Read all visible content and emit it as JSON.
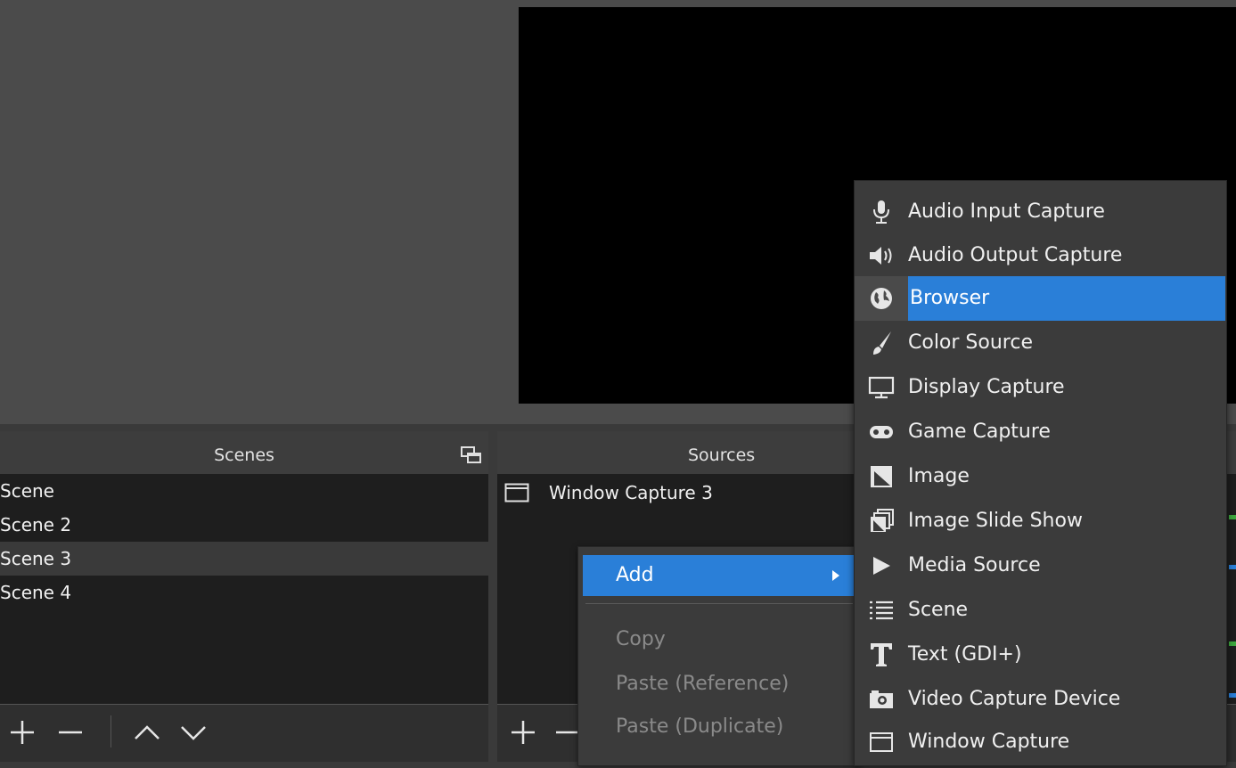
{
  "scenes": {
    "title": "Scenes",
    "items": [
      "Scene",
      "Scene 2",
      "Scene 3",
      "Scene 4"
    ],
    "selected_index": 2
  },
  "sources": {
    "title": "Sources",
    "items": [
      {
        "label": "Window Capture 3",
        "icon": "window-capture-icon"
      }
    ]
  },
  "context_menu": {
    "add_label": "Add",
    "copy_label": "Copy",
    "paste_reference_label": "Paste (Reference)",
    "paste_duplicate_label": "Paste (Duplicate)"
  },
  "add_submenu": {
    "items": [
      {
        "label": "Audio Input Capture",
        "icon": "microphone-icon"
      },
      {
        "label": "Audio Output Capture",
        "icon": "speaker-icon"
      },
      {
        "label": "Browser",
        "icon": "globe-icon"
      },
      {
        "label": "Color Source",
        "icon": "paint-brush-icon"
      },
      {
        "label": "Display Capture",
        "icon": "monitor-icon"
      },
      {
        "label": "Game Capture",
        "icon": "gamepad-icon"
      },
      {
        "label": "Image",
        "icon": "image-icon"
      },
      {
        "label": "Image Slide Show",
        "icon": "slideshow-icon"
      },
      {
        "label": "Media Source",
        "icon": "play-icon"
      },
      {
        "label": "Scene",
        "icon": "list-icon"
      },
      {
        "label": "Text (GDI+)",
        "icon": "text-icon"
      },
      {
        "label": "Video Capture Device",
        "icon": "camera-icon"
      },
      {
        "label": "Window Capture",
        "icon": "window-capture-icon"
      }
    ],
    "highlighted_index": 2
  },
  "colors": {
    "highlight": "#2a7fd8",
    "panel_bg": "#1e1e1e",
    "menu_bg": "#3b3b3b",
    "preview_bg": "#000000"
  }
}
